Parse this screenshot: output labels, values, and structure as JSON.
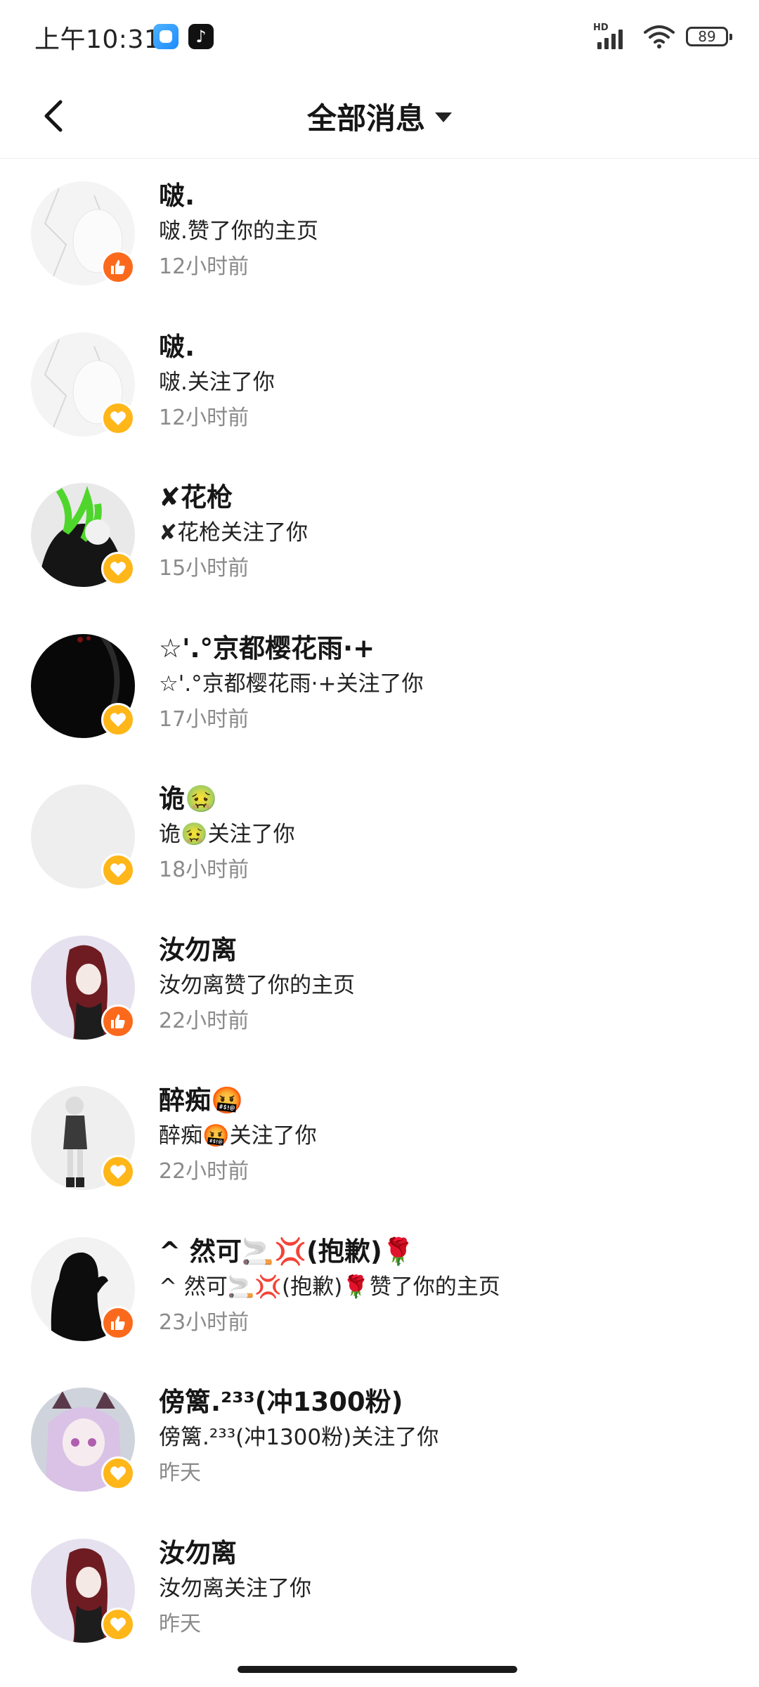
{
  "status_bar": {
    "time": "上午10:31",
    "network_label": "HD",
    "battery": "89"
  },
  "header": {
    "title": "全部消息"
  },
  "messages": [
    {
      "name": "啵.",
      "action": "啵.赞了你的主页",
      "time": "12小时前",
      "type": "like"
    },
    {
      "name": "啵.",
      "action": "啵.关注了你",
      "time": "12小时前",
      "type": "follow"
    },
    {
      "name": "✘花枪",
      "action": "✘花枪关注了你",
      "time": "15小时前",
      "type": "follow"
    },
    {
      "name": "☆'.°京都樱花雨·+",
      "action": "☆'.°京都樱花雨·+关注了你",
      "time": "17小时前",
      "type": "follow"
    },
    {
      "name": "诡🤢",
      "action": "诡🤢关注了你",
      "time": "18小时前",
      "type": "follow"
    },
    {
      "name": "汝勿离",
      "action": "汝勿离赞了你的主页",
      "time": "22小时前",
      "type": "like"
    },
    {
      "name": "醉痴🤬",
      "action": "醉痴🤬关注了你",
      "time": "22小时前",
      "type": "follow"
    },
    {
      "name": "^ 然可🚬💢(抱歉)🌹",
      "action": "^ 然可🚬💢(抱歉)🌹赞了你的主页",
      "time": "23小时前",
      "type": "like"
    },
    {
      "name": "傍篱.²³³(冲1300粉)",
      "action": "傍篱.²³³(冲1300粉)关注了你",
      "time": "昨天",
      "type": "follow"
    },
    {
      "name": "汝勿离",
      "action": "汝勿离关注了你",
      "time": "昨天",
      "type": "follow"
    }
  ],
  "colors": {
    "like_badge": "#fb6a1c",
    "follow_badge": "#ffb619",
    "time_text": "#8a8a8a"
  },
  "icons": {
    "back": "chevron-left-icon",
    "dropdown": "caret-down-icon",
    "like": "thumbs-up-icon",
    "follow": "heart-icon"
  }
}
